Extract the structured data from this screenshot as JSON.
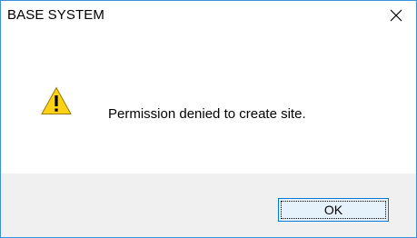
{
  "window": {
    "title": "BASE SYSTEM",
    "close_icon": "close-icon"
  },
  "content": {
    "icon": "warning-icon",
    "message": "Permission denied to create site."
  },
  "footer": {
    "ok_label": "OK"
  },
  "colors": {
    "border": "#3b8fd6",
    "footer_bg": "#f0f0f0",
    "button_bg": "#e5f1fb",
    "button_border": "#0078d7",
    "warning_fill": "#fcd116"
  }
}
